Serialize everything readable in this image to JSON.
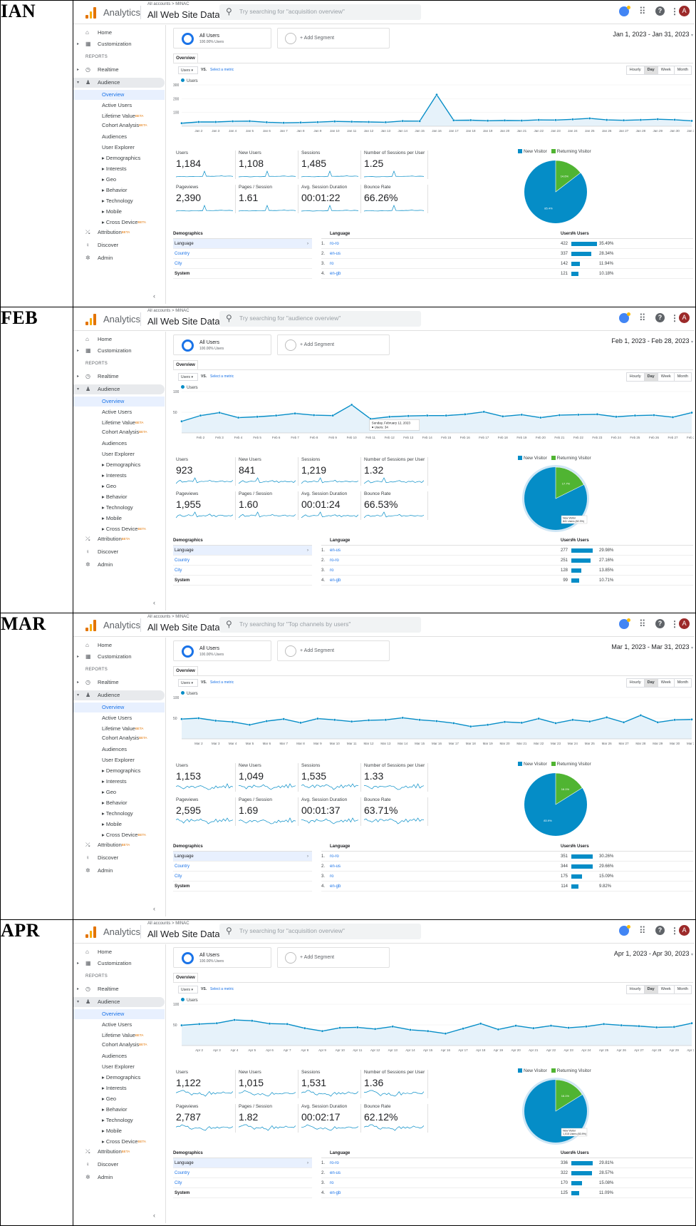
{
  "app": {
    "name": "Analytics",
    "breadcrumb": "All accounts > MINAC",
    "property": "All Web Site Data",
    "icons": [
      "analytics-logo-icon",
      "search-icon",
      "notifications-icon",
      "apps-grid-icon",
      "help-icon",
      "more-vert-icon",
      "account-avatar-icon"
    ],
    "avatar_letter": "A",
    "accent": "#058dc7",
    "returning_color": "#50b432"
  },
  "sidebar": {
    "home": "Home",
    "customization": "Customization",
    "reports": "REPORTS",
    "realtime": "Realtime",
    "audience": "Audience",
    "overview": "Overview",
    "active_users": "Active Users",
    "lifetime_value": "Lifetime Value",
    "cohort": "Cohort Analysis",
    "audiences": "Audiences",
    "user_explorer": "User Explorer",
    "demographics": "Demographics",
    "interests": "Interests",
    "geo": "Geo",
    "behavior": "Behavior",
    "technology": "Technology",
    "mobile": "Mobile",
    "cross_device": "Cross Device",
    "attribution": "Attribution",
    "discover": "Discover",
    "admin": "Admin",
    "beta": "BETA"
  },
  "common": {
    "all_users": "All Users",
    "all_users_pct": "100.00% Users",
    "add_segment": "+ Add Segment",
    "tab_overview": "Overview",
    "metric_select": "Users",
    "vs": "VS.",
    "select_metric": "Select a metric",
    "granularity": [
      "Hourly",
      "Day",
      "Week",
      "Month"
    ],
    "series": "Users",
    "metric_labels": [
      "Users",
      "New Users",
      "Sessions",
      "Number of Sessions per User",
      "Pageviews",
      "Pages / Session",
      "Avg. Session Duration",
      "Bounce Rate"
    ],
    "new_visitor": "New Visitor",
    "returning_visitor": "Returning Visitor",
    "demographics": "Demographics",
    "language": "Language",
    "country": "Country",
    "city": "City",
    "system": "System",
    "users_col": "Users",
    "pct_users_col": "% Users"
  },
  "months": [
    {
      "label": "IAN",
      "search_placeholder": "Try searching for \"acquisition overview\"",
      "date_range": "Jan 1, 2023 - Jan 31, 2023",
      "yticks": [
        "300",
        "200",
        "100"
      ],
      "ymax": 300,
      "values": [
        22,
        31,
        31,
        36,
        37,
        29,
        25,
        27,
        30,
        35,
        33,
        31,
        29,
        38,
        37,
        229,
        43,
        44,
        40,
        42,
        41,
        46,
        45,
        50,
        57,
        46,
        43,
        46,
        51,
        47,
        39
      ],
      "xlabels": [
        "Jan 2",
        "Jan 3",
        "Jan 4",
        "Jan 5",
        "Jan 6",
        "Jan 7",
        "Jan 8",
        "Jan 9",
        "Jan 10",
        "Jan 11",
        "Jan 12",
        "Jan 13",
        "Jan 14",
        "Jan 15",
        "Jan 16",
        "Jan 17",
        "Jan 18",
        "Jan 19",
        "Jan 20",
        "Jan 21",
        "Jan 22",
        "Jan 23",
        "Jan 24",
        "Jan 25",
        "Jan 26",
        "Jan 27",
        "Jan 28",
        "Jan 29",
        "Jan 30",
        "Jan 31"
      ],
      "metrics": [
        "1,184",
        "1,108",
        "1,485",
        "1.25",
        "2,390",
        "1.61",
        "00:01:22",
        "66.26%"
      ],
      "pie": {
        "returning": 14.6,
        "new": 85.4,
        "returning_label": "14.6%",
        "new_label": "85.4%"
      },
      "tooltip": null,
      "languages": [
        {
          "n": "1.",
          "name": "ro-ro",
          "users": "422",
          "pct": "35.49%",
          "frac": 0.3549
        },
        {
          "n": "2.",
          "name": "en-us",
          "users": "337",
          "pct": "28.34%",
          "frac": 0.2834
        },
        {
          "n": "3.",
          "name": "ro",
          "users": "142",
          "pct": "11.94%",
          "frac": 0.1194
        },
        {
          "n": "4.",
          "name": "en-gb",
          "users": "121",
          "pct": "10.18%",
          "frac": 0.1018
        }
      ]
    },
    {
      "label": "FEB",
      "search_placeholder": "Try searching for \"audience overview\"",
      "date_range": "Feb 1, 2023 - Feb 28, 2023",
      "yticks": [
        "100",
        "50"
      ],
      "ymax": 100,
      "values": [
        28,
        42,
        49,
        37,
        39,
        42,
        47,
        43,
        42,
        68,
        34,
        39,
        41,
        42,
        42,
        45,
        51,
        40,
        44,
        37,
        43,
        44,
        45,
        39,
        42,
        43,
        38,
        49
      ],
      "xlabels": [
        "Feb 2",
        "Feb 3",
        "Feb 4",
        "Feb 5",
        "Feb 6",
        "Feb 7",
        "Feb 8",
        "Feb 9",
        "Feb 10",
        "Feb 11",
        "Feb 12",
        "Feb 13",
        "Feb 14",
        "Feb 15",
        "Feb 16",
        "Feb 17",
        "Feb 18",
        "Feb 19",
        "Feb 20",
        "Feb 21",
        "Feb 22",
        "Feb 23",
        "Feb 24",
        "Feb 25",
        "Feb 26",
        "Feb 27",
        "Feb 28"
      ],
      "metrics": [
        "923",
        "841",
        "1,219",
        "1.32",
        "1,955",
        "1.60",
        "00:01:24",
        "66.53%"
      ],
      "pie": {
        "returning": 17.7,
        "new": 82.3,
        "returning_label": "17.7%",
        "new_label": ""
      },
      "tooltip": {
        "title": "Sunday, February 12, 2023",
        "line": "● Users: 34",
        "index": 11
      },
      "pie_tooltip": {
        "title": "New Visitor",
        "line": "841 Users (82.3%)"
      },
      "languages": [
        {
          "n": "1.",
          "name": "en-us",
          "users": "277",
          "pct": "29.98%",
          "frac": 0.2998
        },
        {
          "n": "2.",
          "name": "ro-ro",
          "users": "251",
          "pct": "27.16%",
          "frac": 0.2716
        },
        {
          "n": "3.",
          "name": "ro",
          "users": "128",
          "pct": "13.85%",
          "frac": 0.1385
        },
        {
          "n": "4.",
          "name": "en-gb",
          "users": "99",
          "pct": "10.71%",
          "frac": 0.1071
        }
      ]
    },
    {
      "label": "MAR",
      "search_placeholder": "Try searching for \"Top channels by users\"",
      "date_range": "Mar 1, 2023 - Mar 31, 2023",
      "yticks": [
        "100",
        "50"
      ],
      "ymax": 100,
      "values": [
        48,
        50,
        44,
        41,
        34,
        43,
        48,
        39,
        49,
        46,
        42,
        45,
        46,
        51,
        46,
        43,
        38,
        30,
        34,
        41,
        39,
        49,
        38,
        46,
        42,
        52,
        40,
        57,
        40,
        46,
        47
      ],
      "xlabels": [
        "Mar 2",
        "Mar 3",
        "Mar 4",
        "Mar 5",
        "Mar 6",
        "Mar 7",
        "Mar 8",
        "Mar 9",
        "Mar 10",
        "Mar 11",
        "Mar 12",
        "Mar 13",
        "Mar 14",
        "Mar 15",
        "Mar 16",
        "Mar 17",
        "Mar 18",
        "Mar 19",
        "Mar 20",
        "Mar 21",
        "Mar 22",
        "Mar 23",
        "Mar 24",
        "Mar 25",
        "Mar 26",
        "Mar 27",
        "Mar 28",
        "Mar 29",
        "Mar 30",
        "Mar 31"
      ],
      "metrics": [
        "1,153",
        "1,049",
        "1,535",
        "1.33",
        "2,595",
        "1.69",
        "00:01:37",
        "63.71%"
      ],
      "pie": {
        "returning": 16.1,
        "new": 83.9,
        "returning_label": "16.1%",
        "new_label": "83.9%"
      },
      "tooltip": null,
      "languages": [
        {
          "n": "1.",
          "name": "ro-ro",
          "users": "351",
          "pct": "30.26%",
          "frac": 0.3026
        },
        {
          "n": "2.",
          "name": "en-us",
          "users": "344",
          "pct": "29.66%",
          "frac": 0.2966
        },
        {
          "n": "3.",
          "name": "ro",
          "users": "175",
          "pct": "15.09%",
          "frac": 0.1509
        },
        {
          "n": "4.",
          "name": "en-gb",
          "users": "114",
          "pct": "9.82%",
          "frac": 0.0982
        }
      ]
    },
    {
      "label": "APR",
      "search_placeholder": "Try searching for \"acquisition overview\"",
      "date_range": "Apr 1, 2023 - Apr 30, 2023",
      "yticks": [
        "100",
        "50"
      ],
      "ymax": 100,
      "values": [
        49,
        52,
        54,
        62,
        60,
        53,
        52,
        42,
        35,
        43,
        44,
        40,
        46,
        38,
        35,
        29,
        41,
        53,
        39,
        48,
        42,
        48,
        43,
        46,
        52,
        49,
        47,
        44,
        45,
        54
      ],
      "xlabels": [
        "Apr 2",
        "Apr 3",
        "Apr 4",
        "Apr 5",
        "Apr 6",
        "Apr 7",
        "Apr 8",
        "Apr 9",
        "Apr 10",
        "Apr 11",
        "Apr 12",
        "Apr 13",
        "Apr 14",
        "Apr 15",
        "Apr 16",
        "Apr 17",
        "Apr 18",
        "Apr 19",
        "Apr 20",
        "Apr 21",
        "Apr 22",
        "Apr 23",
        "Apr 24",
        "Apr 25",
        "Apr 26",
        "Apr 27",
        "Apr 28",
        "Apr 29",
        "Apr 30"
      ],
      "metrics": [
        "1,122",
        "1,015",
        "1,531",
        "1.36",
        "2,787",
        "1.82",
        "00:02:17",
        "62.12%"
      ],
      "pie": {
        "returning": 16.1,
        "new": 83.9,
        "returning_label": "16.1%",
        "new_label": ""
      },
      "tooltip": null,
      "pie_tooltip": {
        "title": "New Visitor",
        "line": "1,015 Users (83.9%)"
      },
      "languages": [
        {
          "n": "1.",
          "name": "ro-ro",
          "users": "336",
          "pct": "29.81%",
          "frac": 0.2981
        },
        {
          "n": "2.",
          "name": "en-us",
          "users": "322",
          "pct": "28.57%",
          "frac": 0.2857
        },
        {
          "n": "3.",
          "name": "ro",
          "users": "170",
          "pct": "15.08%",
          "frac": 0.1508
        },
        {
          "n": "4.",
          "name": "en-gb",
          "users": "125",
          "pct": "11.09%",
          "frac": 0.1109
        }
      ]
    }
  ]
}
